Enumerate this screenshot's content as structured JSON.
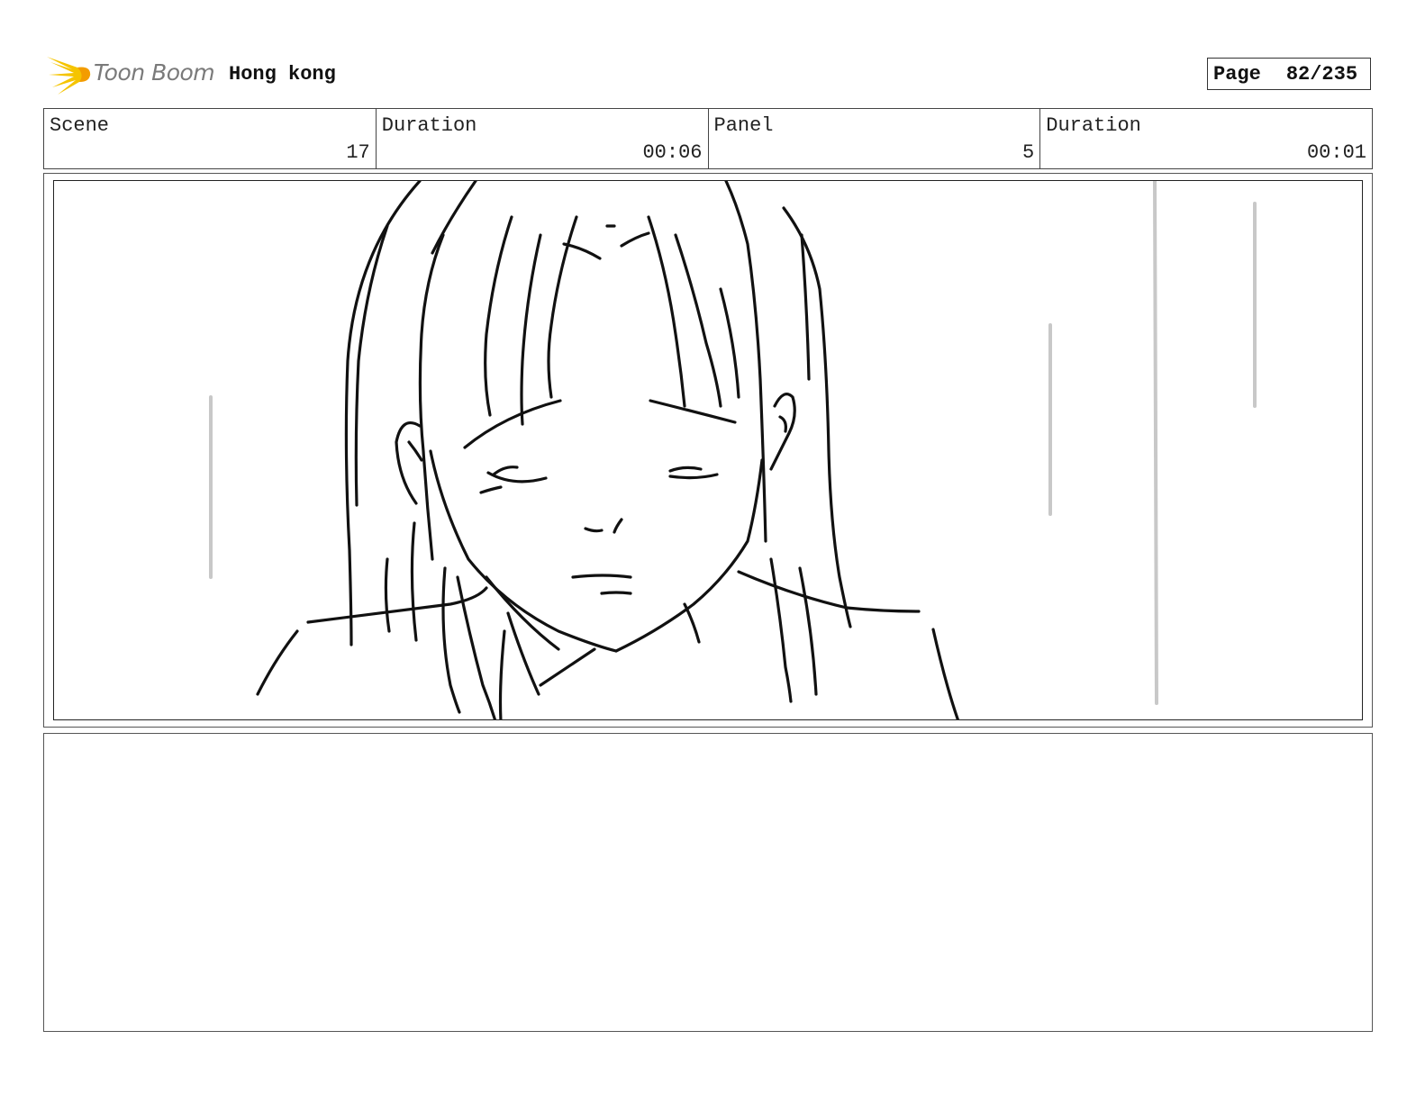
{
  "header": {
    "logo_text": "Toon Boom",
    "project_title": "Hong kong",
    "page_label": "Page",
    "page_number": "82/235"
  },
  "info": {
    "scene_label": "Scene",
    "scene_value": "17",
    "scene_duration_label": "Duration",
    "scene_duration_value": "00:06",
    "panel_label": "Panel",
    "panel_value": "5",
    "panel_duration_label": "Duration",
    "panel_duration_value": "00:01"
  },
  "colors": {
    "logo_accent": "#f5c400",
    "ink": "#111111",
    "rain": "#c8c8c8"
  }
}
